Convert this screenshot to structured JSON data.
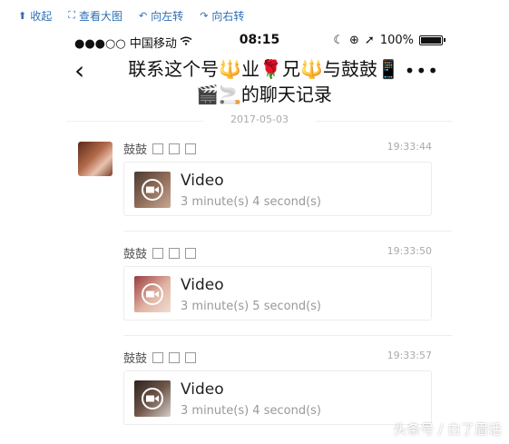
{
  "toolbar": {
    "items": [
      {
        "icon": "collapse-icon",
        "label": "收起"
      },
      {
        "icon": "zoom-icon",
        "label": "查看大图"
      },
      {
        "icon": "rotate-left-icon",
        "label": "向左转"
      },
      {
        "icon": "rotate-right-icon",
        "label": "向右转"
      }
    ]
  },
  "status": {
    "carrier": "●●●○○ 中国移动",
    "time": "08:15",
    "battery": "100%"
  },
  "nav": {
    "title": "联系这个号🔱业🌹兄🔱与鼓鼓📱🎬🚬的聊天记录"
  },
  "date": "2017-05-03",
  "messages": [
    {
      "sender": "鼓鼓",
      "time": "19:33:44",
      "type": "Video",
      "duration": "3 minute(s) 4 second(s)"
    },
    {
      "sender": "鼓鼓",
      "time": "19:33:50",
      "type": "Video",
      "duration": "3 minute(s) 5 second(s)"
    },
    {
      "sender": "鼓鼓",
      "time": "19:33:57",
      "type": "Video",
      "duration": "3 minute(s) 4 second(s)"
    }
  ],
  "watermark": "头条号 / 白了眉话",
  "colors": {
    "link": "#2f6fb5",
    "muted": "#999999"
  }
}
